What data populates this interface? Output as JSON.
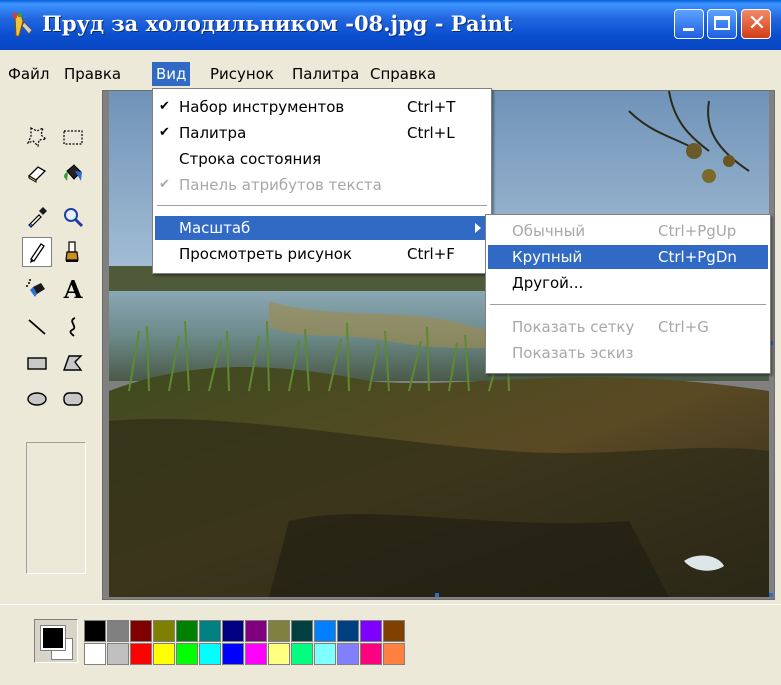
{
  "window": {
    "title": "Пруд за холодильником -08.jpg - Paint",
    "controls": {
      "minimize": "minimize",
      "maximize": "maximize",
      "close": "✕"
    }
  },
  "menubar": {
    "items": [
      "Файл",
      "Правка",
      "Вид",
      "Рисунок",
      "Палитра",
      "Справка"
    ],
    "active": "Вид"
  },
  "view_menu": {
    "items": [
      {
        "label": "Набор инструментов",
        "shortcut": "Ctrl+T",
        "checked": true,
        "check": "✔"
      },
      {
        "label": "Палитра",
        "shortcut": "Ctrl+L",
        "checked": true,
        "check": "✔"
      },
      {
        "label": "Строка состояния",
        "shortcut": "",
        "checked": false
      },
      {
        "label": "Панель атрибутов текста",
        "shortcut": "",
        "checked": true,
        "check": "✔",
        "disabled": true
      },
      {
        "label": "Масштаб",
        "shortcut": "",
        "submenu": true,
        "highlighted": true
      },
      {
        "label": "Просмотреть рисунок",
        "shortcut": "Ctrl+F"
      }
    ]
  },
  "zoom_submenu": {
    "items": [
      {
        "label": "Обычный",
        "shortcut": "Ctrl+PgUp",
        "disabled": true
      },
      {
        "label": "Крупный",
        "shortcut": "Ctrl+PgDn",
        "highlighted": true
      },
      {
        "label": "Другой...",
        "shortcut": ""
      },
      {
        "label": "Показать сетку",
        "shortcut": "Ctrl+G",
        "disabled": true
      },
      {
        "label": "Показать эскиз",
        "shortcut": "",
        "disabled": true
      }
    ]
  },
  "tools": {
    "icons": [
      "free-select",
      "rect-select",
      "eraser",
      "fill",
      "color-picker",
      "magnifier",
      "pencil",
      "brush",
      "airbrush",
      "text",
      "line",
      "curve",
      "rectangle",
      "polygon",
      "ellipse",
      "rounded-rectangle"
    ],
    "selected": "pencil",
    "text_tool_glyph": "A"
  },
  "palette": {
    "foreground": "#000000",
    "background": "#ffffff",
    "colors_top": [
      "#000000",
      "#808080",
      "#800000",
      "#808000",
      "#008000",
      "#008080",
      "#000080",
      "#800080",
      "#808040",
      "#004040",
      "#0080FF",
      "#004080",
      "#8000FF",
      "#804000"
    ],
    "colors_bottom": [
      "#FFFFFF",
      "#C0C0C0",
      "#FF0000",
      "#FFFF00",
      "#00FF00",
      "#00FFFF",
      "#0000FF",
      "#FF00FF",
      "#FFFF80",
      "#00FF80",
      "#80FFFF",
      "#8080FF",
      "#FF0080",
      "#FF8040"
    ]
  },
  "colors": {
    "titlebar": "#0A4FD0",
    "menu_highlight": "#316AC5",
    "window_bg": "#ECE9D8"
  }
}
